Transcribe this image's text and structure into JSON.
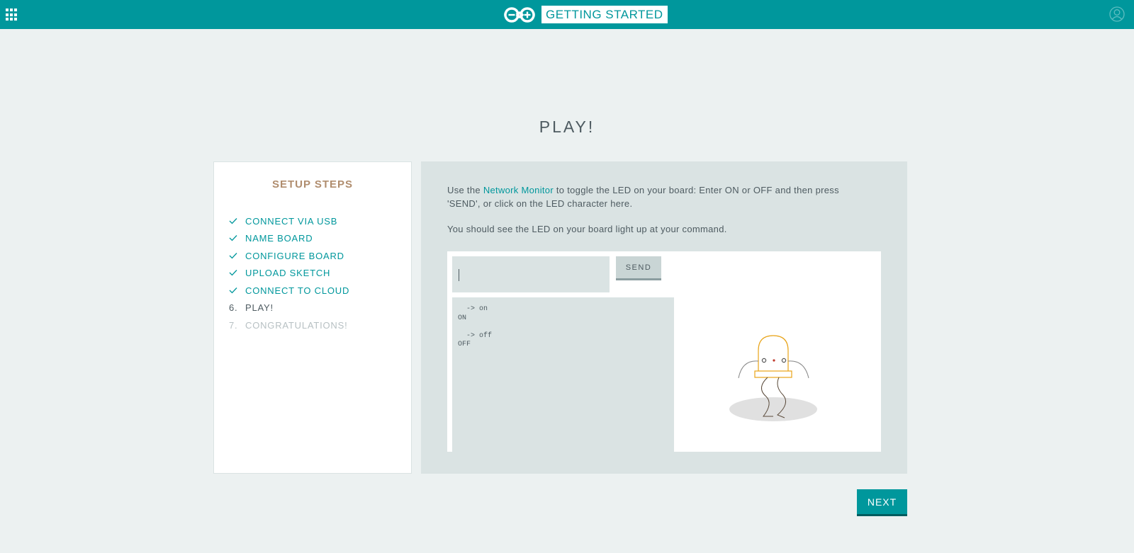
{
  "header": {
    "title": "GETTING STARTED",
    "apps_icon": "apps-grid-icon",
    "user_icon": "user-account-icon",
    "logo": "arduino-logo",
    "bar_color": "#00979c"
  },
  "page": {
    "title": "PLAY!"
  },
  "steps": {
    "heading": "SETUP STEPS",
    "items": [
      {
        "mark": "check",
        "label": "CONNECT VIA USB",
        "state": "done"
      },
      {
        "mark": "check",
        "label": "NAME BOARD",
        "state": "done"
      },
      {
        "mark": "check",
        "label": "CONFIGURE BOARD",
        "state": "done"
      },
      {
        "mark": "check",
        "label": "UPLOAD SKETCH",
        "state": "done"
      },
      {
        "mark": "check",
        "label": "CONNECT TO CLOUD",
        "state": "done"
      },
      {
        "mark": "6.",
        "label": "PLAY!",
        "state": "current"
      },
      {
        "mark": "7.",
        "label": "CONGRATULATIONS!",
        "state": "pending"
      }
    ]
  },
  "instructions": {
    "p1_before": "Use the ",
    "p1_link": "Network Monitor",
    "p1_after": " to toggle the LED on your board: Enter ON or OFF and then press 'SEND', or click on the LED character here.",
    "p2": "You should see the LED on your board light up at your command."
  },
  "monitor": {
    "input_value": "",
    "send_label": "SEND",
    "log": "  -> on\nON\n\n  -> off\nOFF"
  },
  "led": {
    "icon": "led-character-icon",
    "color": "#e8a317"
  },
  "next_label": "NEXT"
}
